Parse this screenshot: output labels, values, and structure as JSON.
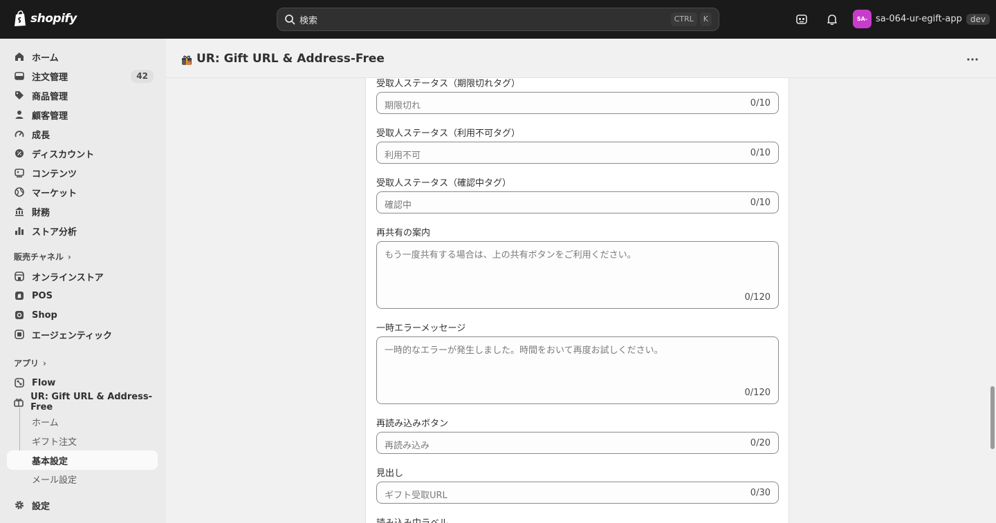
{
  "topbar": {
    "logo_text": "shopify",
    "search_placeholder": "検索",
    "shortcut_ctrl": "CTRL",
    "shortcut_key": "K",
    "store_avatar": "SA-",
    "store_name": "sa-064-ur-egift-app",
    "env_badge": "dev"
  },
  "sidebar": {
    "items": [
      {
        "label": "ホーム",
        "icon": "home-icon"
      },
      {
        "label": "注文管理",
        "icon": "orders-icon",
        "count": "42"
      },
      {
        "label": "商品管理",
        "icon": "tag-icon"
      },
      {
        "label": "顧客管理",
        "icon": "person-icon"
      },
      {
        "label": "成長",
        "icon": "gauge-icon"
      },
      {
        "label": "ディスカウント",
        "icon": "discount-icon"
      },
      {
        "label": "コンテンツ",
        "icon": "content-icon"
      },
      {
        "label": "マーケット",
        "icon": "globe-icon"
      },
      {
        "label": "財務",
        "icon": "bank-icon"
      },
      {
        "label": "ストア分析",
        "icon": "bar-chart-icon"
      }
    ],
    "sales_channels_heading": "販売チャネル",
    "channels": [
      {
        "label": "オンラインストア",
        "icon": "store-icon"
      },
      {
        "label": "POS",
        "icon": "pos-icon"
      },
      {
        "label": "Shop",
        "icon": "shop-icon"
      },
      {
        "label": "エージェンティック",
        "icon": "agentic-icon"
      }
    ],
    "apps_heading": "アプリ",
    "apps": [
      {
        "label": "Flow",
        "icon": "flow-icon"
      },
      {
        "label": "UR: Gift URL & Address-Free",
        "icon": "gift-app-icon"
      }
    ],
    "app_subitems": [
      {
        "label": "ホーム"
      },
      {
        "label": "ギフト注文"
      },
      {
        "label": "基本設定"
      },
      {
        "label": "メール設定"
      }
    ],
    "settings_label": "設定"
  },
  "page": {
    "title": "UR: Gift URL & Address-Free"
  },
  "form": {
    "fields": [
      {
        "label": "受取人ステータス（期限切れタグ）",
        "placeholder": "期限切れ",
        "counter": "0/10",
        "multiline": false
      },
      {
        "label": "受取人ステータス（利用不可タグ）",
        "placeholder": "利用不可",
        "counter": "0/10",
        "multiline": false
      },
      {
        "label": "受取人ステータス（確認中タグ）",
        "placeholder": "確認中",
        "counter": "0/10",
        "multiline": false
      },
      {
        "label": "再共有の案内",
        "placeholder": "もう一度共有する場合は、上の共有ボタンをご利用ください。",
        "counter": "0/120",
        "multiline": true
      },
      {
        "label": "一時エラーメッセージ",
        "placeholder": "一時的なエラーが発生しました。時間をおいて再度お試しください。",
        "counter": "0/120",
        "multiline": true
      },
      {
        "label": "再読み込みボタン",
        "placeholder": "再読み込み",
        "counter": "0/20",
        "multiline": false
      },
      {
        "label": "見出し",
        "placeholder": "ギフト受取URL",
        "counter": "0/30",
        "multiline": false
      },
      {
        "label": "読み込み中ラベル"
      }
    ]
  },
  "colors": {
    "topbar_bg": "#1a1a1a",
    "sidebar_bg": "#ebebeb",
    "avatar_bg": "#c93bcb",
    "card_bg": "#ffffff"
  }
}
